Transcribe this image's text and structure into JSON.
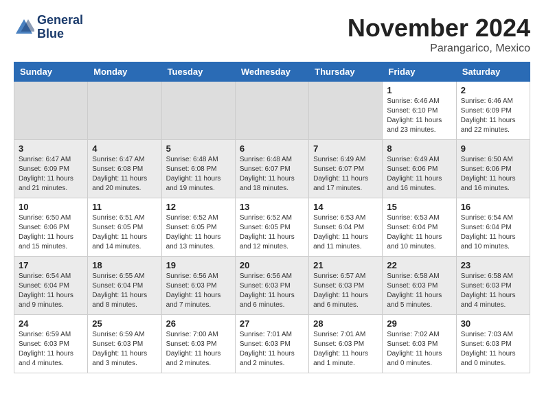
{
  "header": {
    "logo_line1": "General",
    "logo_line2": "Blue",
    "month": "November 2024",
    "location": "Parangarico, Mexico"
  },
  "weekdays": [
    "Sunday",
    "Monday",
    "Tuesday",
    "Wednesday",
    "Thursday",
    "Friday",
    "Saturday"
  ],
  "weeks": [
    {
      "bg": "white",
      "days": [
        {
          "num": "",
          "info": ""
        },
        {
          "num": "",
          "info": ""
        },
        {
          "num": "",
          "info": ""
        },
        {
          "num": "",
          "info": ""
        },
        {
          "num": "",
          "info": ""
        },
        {
          "num": "1",
          "info": "Sunrise: 6:46 AM\nSunset: 6:10 PM\nDaylight: 11 hours and 23 minutes."
        },
        {
          "num": "2",
          "info": "Sunrise: 6:46 AM\nSunset: 6:09 PM\nDaylight: 11 hours and 22 minutes."
        }
      ]
    },
    {
      "bg": "gray",
      "days": [
        {
          "num": "3",
          "info": "Sunrise: 6:47 AM\nSunset: 6:09 PM\nDaylight: 11 hours and 21 minutes."
        },
        {
          "num": "4",
          "info": "Sunrise: 6:47 AM\nSunset: 6:08 PM\nDaylight: 11 hours and 20 minutes."
        },
        {
          "num": "5",
          "info": "Sunrise: 6:48 AM\nSunset: 6:08 PM\nDaylight: 11 hours and 19 minutes."
        },
        {
          "num": "6",
          "info": "Sunrise: 6:48 AM\nSunset: 6:07 PM\nDaylight: 11 hours and 18 minutes."
        },
        {
          "num": "7",
          "info": "Sunrise: 6:49 AM\nSunset: 6:07 PM\nDaylight: 11 hours and 17 minutes."
        },
        {
          "num": "8",
          "info": "Sunrise: 6:49 AM\nSunset: 6:06 PM\nDaylight: 11 hours and 16 minutes."
        },
        {
          "num": "9",
          "info": "Sunrise: 6:50 AM\nSunset: 6:06 PM\nDaylight: 11 hours and 16 minutes."
        }
      ]
    },
    {
      "bg": "white",
      "days": [
        {
          "num": "10",
          "info": "Sunrise: 6:50 AM\nSunset: 6:06 PM\nDaylight: 11 hours and 15 minutes."
        },
        {
          "num": "11",
          "info": "Sunrise: 6:51 AM\nSunset: 6:05 PM\nDaylight: 11 hours and 14 minutes."
        },
        {
          "num": "12",
          "info": "Sunrise: 6:52 AM\nSunset: 6:05 PM\nDaylight: 11 hours and 13 minutes."
        },
        {
          "num": "13",
          "info": "Sunrise: 6:52 AM\nSunset: 6:05 PM\nDaylight: 11 hours and 12 minutes."
        },
        {
          "num": "14",
          "info": "Sunrise: 6:53 AM\nSunset: 6:04 PM\nDaylight: 11 hours and 11 minutes."
        },
        {
          "num": "15",
          "info": "Sunrise: 6:53 AM\nSunset: 6:04 PM\nDaylight: 11 hours and 10 minutes."
        },
        {
          "num": "16",
          "info": "Sunrise: 6:54 AM\nSunset: 6:04 PM\nDaylight: 11 hours and 10 minutes."
        }
      ]
    },
    {
      "bg": "gray",
      "days": [
        {
          "num": "17",
          "info": "Sunrise: 6:54 AM\nSunset: 6:04 PM\nDaylight: 11 hours and 9 minutes."
        },
        {
          "num": "18",
          "info": "Sunrise: 6:55 AM\nSunset: 6:04 PM\nDaylight: 11 hours and 8 minutes."
        },
        {
          "num": "19",
          "info": "Sunrise: 6:56 AM\nSunset: 6:03 PM\nDaylight: 11 hours and 7 minutes."
        },
        {
          "num": "20",
          "info": "Sunrise: 6:56 AM\nSunset: 6:03 PM\nDaylight: 11 hours and 6 minutes."
        },
        {
          "num": "21",
          "info": "Sunrise: 6:57 AM\nSunset: 6:03 PM\nDaylight: 11 hours and 6 minutes."
        },
        {
          "num": "22",
          "info": "Sunrise: 6:58 AM\nSunset: 6:03 PM\nDaylight: 11 hours and 5 minutes."
        },
        {
          "num": "23",
          "info": "Sunrise: 6:58 AM\nSunset: 6:03 PM\nDaylight: 11 hours and 4 minutes."
        }
      ]
    },
    {
      "bg": "white",
      "days": [
        {
          "num": "24",
          "info": "Sunrise: 6:59 AM\nSunset: 6:03 PM\nDaylight: 11 hours and 4 minutes."
        },
        {
          "num": "25",
          "info": "Sunrise: 6:59 AM\nSunset: 6:03 PM\nDaylight: 11 hours and 3 minutes."
        },
        {
          "num": "26",
          "info": "Sunrise: 7:00 AM\nSunset: 6:03 PM\nDaylight: 11 hours and 2 minutes."
        },
        {
          "num": "27",
          "info": "Sunrise: 7:01 AM\nSunset: 6:03 PM\nDaylight: 11 hours and 2 minutes."
        },
        {
          "num": "28",
          "info": "Sunrise: 7:01 AM\nSunset: 6:03 PM\nDaylight: 11 hours and 1 minute."
        },
        {
          "num": "29",
          "info": "Sunrise: 7:02 AM\nSunset: 6:03 PM\nDaylight: 11 hours and 0 minutes."
        },
        {
          "num": "30",
          "info": "Sunrise: 7:03 AM\nSunset: 6:03 PM\nDaylight: 11 hours and 0 minutes."
        }
      ]
    }
  ]
}
